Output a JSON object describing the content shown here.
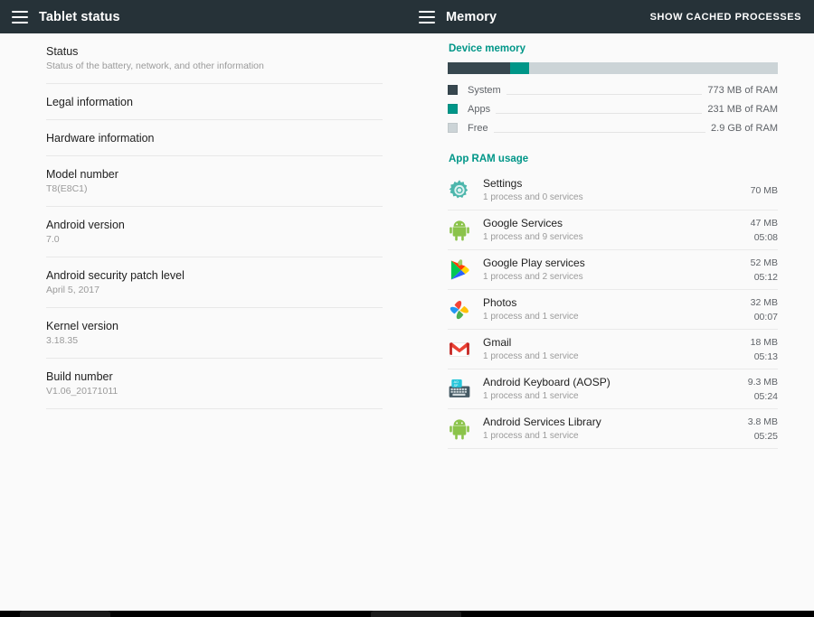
{
  "left_pane": {
    "appbar": {
      "menu_icon": "hamburger-menu-icon",
      "title": "Tablet status"
    },
    "items": [
      {
        "title": "Status",
        "subtitle": "Status of the battery, network, and other information"
      },
      {
        "title": "Legal information",
        "subtitle": ""
      },
      {
        "title": "Hardware information",
        "subtitle": ""
      },
      {
        "title": "Model number",
        "subtitle": "T8(E8C1)"
      },
      {
        "title": "Android version",
        "subtitle": "7.0"
      },
      {
        "title": "Android security patch level",
        "subtitle": "April 5, 2017"
      },
      {
        "title": "Kernel version",
        "subtitle": "3.18.35"
      },
      {
        "title": "Build number",
        "subtitle": "V1.06_20171011"
      }
    ]
  },
  "right_pane": {
    "appbar": {
      "menu_icon": "hamburger-menu-icon",
      "title": "Memory",
      "action_label": "SHOW CACHED PROCESSES"
    },
    "device_memory": {
      "heading": "Device memory",
      "accent_color": "#009688",
      "bar": [
        {
          "key": "system",
          "color": "#37474f",
          "percent": 19.0
        },
        {
          "key": "apps",
          "color": "#009688",
          "percent": 5.7
        },
        {
          "key": "free",
          "color": "#ccd4d7",
          "percent": 75.3
        }
      ],
      "legend": [
        {
          "label": "System",
          "value": "773 MB of RAM",
          "color": "#37474f"
        },
        {
          "label": "Apps",
          "value": "231 MB of RAM",
          "color": "#009688"
        },
        {
          "label": "Free",
          "value": "2.9 GB of RAM",
          "color": "#ccd4d7"
        }
      ]
    },
    "app_ram_usage": {
      "heading": "App RAM usage",
      "apps": [
        {
          "name": "Settings",
          "processes": "1 process and 0 services",
          "size": "70 MB",
          "time": "",
          "icon": "settings-gear-icon"
        },
        {
          "name": "Google Services",
          "processes": "1 process and 9 services",
          "size": "47 MB",
          "time": "05:08",
          "icon": "android-robot-icon"
        },
        {
          "name": "Google Play services",
          "processes": "1 process and 2 services",
          "size": "52 MB",
          "time": "05:12",
          "icon": "google-play-services-icon"
        },
        {
          "name": "Photos",
          "processes": "1 process and 1 service",
          "size": "32 MB",
          "time": "00:07",
          "icon": "google-photos-icon"
        },
        {
          "name": "Gmail",
          "processes": "1 process and 1 service",
          "size": "18 MB",
          "time": "05:13",
          "icon": "gmail-icon"
        },
        {
          "name": "Android Keyboard (AOSP)",
          "processes": "1 process and 1 service",
          "size": "9.3 MB",
          "time": "05:24",
          "icon": "keyboard-icon"
        },
        {
          "name": "Android Services Library",
          "processes": "1 process and 1 service",
          "size": "3.8 MB",
          "time": "05:25",
          "icon": "android-robot-icon"
        }
      ]
    }
  }
}
